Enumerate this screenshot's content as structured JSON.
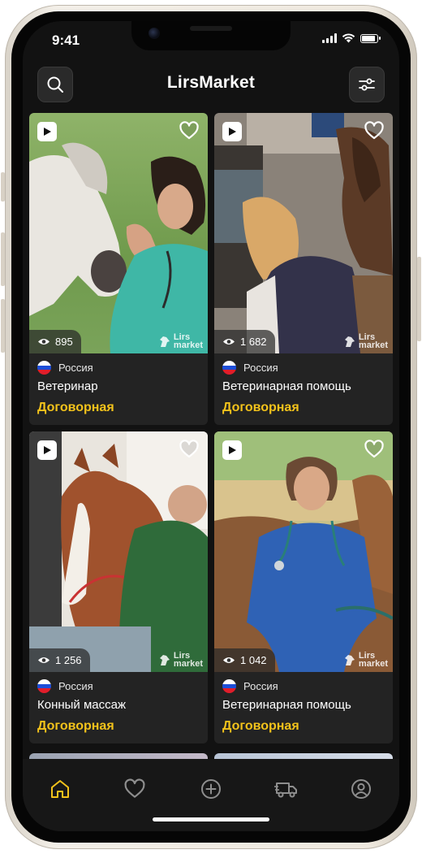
{
  "status_bar": {
    "time": "9:41"
  },
  "header": {
    "title": "LirsMarket",
    "search_icon": "search-icon",
    "filter_icon": "sliders-icon"
  },
  "cards": [
    {
      "title": "Ветеринар",
      "country": "Россия",
      "price": "Договорная",
      "views": "895",
      "watermark": [
        "Lirs",
        "market"
      ]
    },
    {
      "title": "Ветеринарная помощь",
      "country": "Россия",
      "price": "Договорная",
      "views": "1 682",
      "watermark": [
        "Lirs",
        "market"
      ]
    },
    {
      "title": "Конный массаж",
      "country": "Россия",
      "price": "Договорная",
      "views": "1 256",
      "watermark": [
        "Lirs",
        "market"
      ]
    },
    {
      "title": "Ветеринарная помощь",
      "country": "Россия",
      "price": "Договорная",
      "views": "1 042",
      "watermark": [
        "Lirs",
        "market"
      ]
    }
  ],
  "tabbar": {
    "items": [
      {
        "icon": "home-icon",
        "active": true
      },
      {
        "icon": "heart-icon",
        "active": false
      },
      {
        "icon": "plus-circle-icon",
        "active": false
      },
      {
        "icon": "truck-icon",
        "active": false
      },
      {
        "icon": "profile-icon",
        "active": false
      }
    ]
  },
  "colors": {
    "background": "#121212",
    "card": "#232323",
    "price": "#f2c21b",
    "active_tab": "#f2c21b",
    "inactive_tab": "#8e8e8e"
  }
}
